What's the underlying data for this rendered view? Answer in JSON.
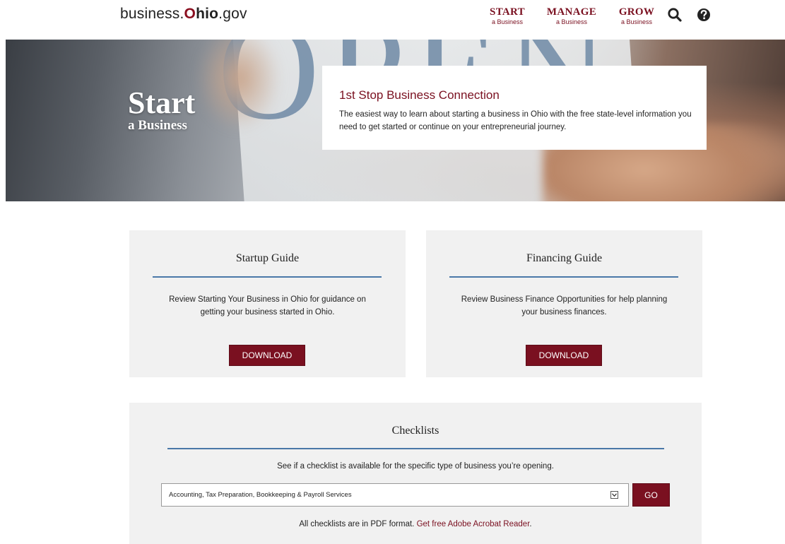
{
  "header": {
    "logo": {
      "prefix": "business.",
      "o": "O",
      "hio": "hio",
      "suffix": ".gov"
    },
    "nav": [
      {
        "main": "START",
        "sub": "a Business"
      },
      {
        "main": "MANAGE",
        "sub": "a Business"
      },
      {
        "main": "GROW",
        "sub": "a Business"
      }
    ],
    "icons": {
      "search": "search-icon",
      "help": "help-icon"
    }
  },
  "hero": {
    "title_big": "Start",
    "title_small": "a Business",
    "card_title": "1st Stop Business Connection",
    "card_desc": "The easiest way to learn about starting a business in Ohio with the free state-level information you need to get started or continue on your entrepreneurial journey."
  },
  "guides": {
    "startup": {
      "title": "Startup Guide",
      "desc": "Review Starting Your Business in Ohio for guidance on getting your business started in Ohio.",
      "button": "DOWNLOAD"
    },
    "financing": {
      "title": "Financing Guide",
      "desc": "Review Business Finance Opportunities for help planning your business finances.",
      "button": "DOWNLOAD"
    }
  },
  "checklists": {
    "title": "Checklists",
    "desc": "See if a checklist is available for the specific type of business you’re opening.",
    "selected": "Accounting, Tax Preparation, Bookkeeping & Payroll Services",
    "go": "GO",
    "footnote_text": "All checklists are in PDF format.",
    "footnote_link": "Get free Adobe Acrobat Reader",
    "footnote_end": "."
  },
  "colors": {
    "brand": "#7a1020",
    "rule": "#4a78a8",
    "panel": "#f1f1f1"
  }
}
